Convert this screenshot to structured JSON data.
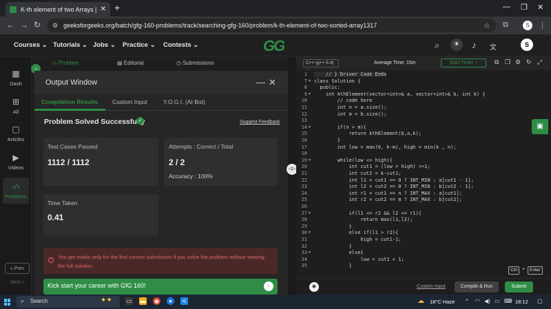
{
  "browser": {
    "tab_title": "K-th element of two Arrays | Pr...",
    "tab_close": "✕",
    "new_tab": "+",
    "url": "geeksforgeeks.org/batch/gfg-160-problems/track/searching-gfg-160/problem/k-th-element-of-two-sorted-array1317",
    "profile_initial": "S"
  },
  "header": {
    "nav": [
      "Courses",
      "Tutorials",
      "Jobs",
      "Practice",
      "Contests"
    ],
    "logo": "GG",
    "avatar": "S"
  },
  "rail": {
    "items": [
      {
        "label": "Dash",
        "icon": "dashboard-icon"
      },
      {
        "label": "All",
        "icon": "grid-icon"
      },
      {
        "label": "Articles",
        "icon": "book-icon"
      },
      {
        "label": "Videos",
        "icon": "video-icon"
      },
      {
        "label": "Problems",
        "icon": "code-icon"
      }
    ],
    "prev": "« Prev",
    "next": "Next »"
  },
  "problem_tabs": {
    "problem": "Problem",
    "editorial": "Editorial",
    "submissions": "Submissions"
  },
  "output": {
    "title": "Output Window",
    "tabs": [
      "Compilation Results",
      "Custom Input",
      "Y.O.G.I. (AI Bot)"
    ],
    "status": "Problem Solved Successfully",
    "suggest": "Suggest Feedback",
    "test_label": "Test Cases Passed",
    "test_value": "1112 / 1112",
    "attempts_label": "Attempts : Correct / Total",
    "attempts_value": "2 / 2",
    "accuracy": "Accuracy : 100%",
    "time_label": "Time Taken",
    "time_value": "0.41",
    "warning": "You get marks only for the first correct submission if you solve the problem without viewing the full solution.",
    "banner": "Kick start your career with GfG 160!"
  },
  "editor": {
    "language": "C++ (g++ 5.4)",
    "avg_time": "Average Time: 15m",
    "timer": "Start Timer",
    "custom_input": "Custom Input",
    "compile_run": "Compile & Run",
    "submit": "Submit",
    "kbd_ctrl": "Ctrl",
    "kbd_plus": "+",
    "kbd_enter": "Enter",
    "lines": [
      {
        "n": "1",
        "t": "    // } Driver Code Ends"
      },
      {
        "n": "7",
        "t": "class Solution {"
      },
      {
        "n": "8",
        "t": "  public:"
      },
      {
        "n": "9",
        "t": "    int kthElement(vector<int>& a, vector<int>& b, int k) {"
      },
      {
        "n": "10",
        "t": "        // code here"
      },
      {
        "n": "11",
        "t": "        int n = a.size();"
      },
      {
        "n": "12",
        "t": "        int m = b.size();"
      },
      {
        "n": "13",
        "t": ""
      },
      {
        "n": "14",
        "t": "        if(n > m){"
      },
      {
        "n": "15",
        "t": "            return kthElement(b,a,k);"
      },
      {
        "n": "16",
        "t": "        }"
      },
      {
        "n": "17",
        "t": "        int low = max(0, k-m), high = min(k , n);"
      },
      {
        "n": "18",
        "t": ""
      },
      {
        "n": "19",
        "t": "        while(low <= high){"
      },
      {
        "n": "20",
        "t": "            int cut1 = (low + high) >>1;"
      },
      {
        "n": "21",
        "t": "            int cut2 = k-cut1;"
      },
      {
        "n": "22",
        "t": "            int l1 = cut1 == 0 ? INT_MIN : a[cut1 - 1];"
      },
      {
        "n": "23",
        "t": "            int l2 = cut2 == 0 ? INT_MIN : b[cut2 - 1];"
      },
      {
        "n": "24",
        "t": "            int r1 = cut1 == n ? INT_MAX : a[cut1];"
      },
      {
        "n": "25",
        "t": "            int r2 = cut2 == m ? INT_MAX : b[cut2];"
      },
      {
        "n": "26",
        "t": ""
      },
      {
        "n": "27",
        "t": "            if(l1 <= r2 && l2 <= r1){"
      },
      {
        "n": "28",
        "t": "                return max(l1,l2);"
      },
      {
        "n": "29",
        "t": "            }"
      },
      {
        "n": "30",
        "t": "            else if(l1 > r2){"
      },
      {
        "n": "31",
        "t": "                high = cut1-1;"
      },
      {
        "n": "32",
        "t": "            }"
      },
      {
        "n": "33",
        "t": "            else{"
      },
      {
        "n": "34",
        "t": "                low = cut1 + 1;"
      },
      {
        "n": "35",
        "t": "            }"
      }
    ]
  },
  "taskbar": {
    "search": "Search",
    "weather": "18°C Haze",
    "time": "18:12"
  },
  "colors": {
    "accent": "#2f8d46",
    "warning": "#e06666"
  }
}
